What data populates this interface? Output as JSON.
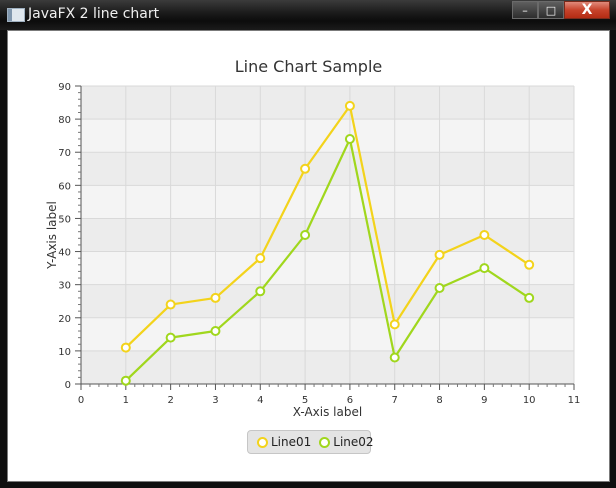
{
  "window": {
    "title": "JavaFX 2 line chart",
    "controls": {
      "minimize": "–",
      "maximize": "□",
      "close": "X"
    }
  },
  "colors": {
    "series1": "#f3d31b",
    "series2": "#a0d71d",
    "band_light": "#f4f4f4",
    "band_dark": "#ececec",
    "grid": "#d9d9d9"
  },
  "chart_data": {
    "type": "line",
    "title": "Line Chart Sample",
    "xlabel": "X-Axis label",
    "ylabel": "Y-Axis label",
    "xlim": [
      0,
      11
    ],
    "ylim": [
      0,
      90
    ],
    "xticks": [
      0,
      1,
      2,
      3,
      4,
      5,
      6,
      7,
      8,
      9,
      10,
      11
    ],
    "yticks": [
      0,
      10,
      20,
      30,
      40,
      50,
      60,
      70,
      80,
      90
    ],
    "grid": true,
    "legend_position": "bottom",
    "x": [
      1,
      2,
      3,
      4,
      5,
      6,
      7,
      8,
      9,
      10
    ],
    "series": [
      {
        "name": "Line01",
        "values": [
          11,
          24,
          26,
          38,
          65,
          84,
          18,
          39,
          45,
          36
        ]
      },
      {
        "name": "Line02",
        "values": [
          1,
          14,
          16,
          28,
          45,
          74,
          8,
          29,
          35,
          26
        ]
      }
    ]
  }
}
